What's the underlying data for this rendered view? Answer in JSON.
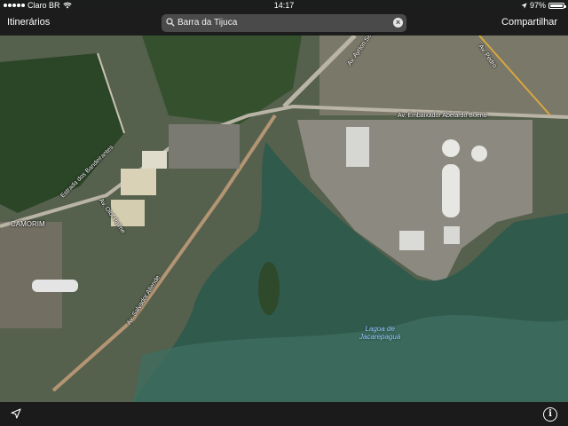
{
  "status_bar": {
    "carrier": "Claro BR",
    "time": "14:17",
    "battery": "97%"
  },
  "toolbar": {
    "left_button": "Itinerários",
    "search_value": "Barra da Tijuca",
    "right_button": "Compartilhar"
  },
  "map": {
    "labels": {
      "avenida_dos_bandeirantes": "Estrada dos Bandeirantes",
      "camorim": "CAMORIM",
      "av_olof_palme": "Av. Olof Palme",
      "av_salvador_allende": "Av. Salvador Allende",
      "av_embaixador": "Av. Embaixador Abelardo Bueno",
      "av_ayrton_senna": "Av. Ayrton Senna",
      "av_pedro": "Av. Pedro",
      "lagoa_line1": "Lagoa de",
      "lagoa_line2": "Jacarepaguá"
    }
  },
  "colors": {
    "lagoon": "#2f5a4c",
    "forest": "#2b4527",
    "urban": "#7d7a6d"
  }
}
